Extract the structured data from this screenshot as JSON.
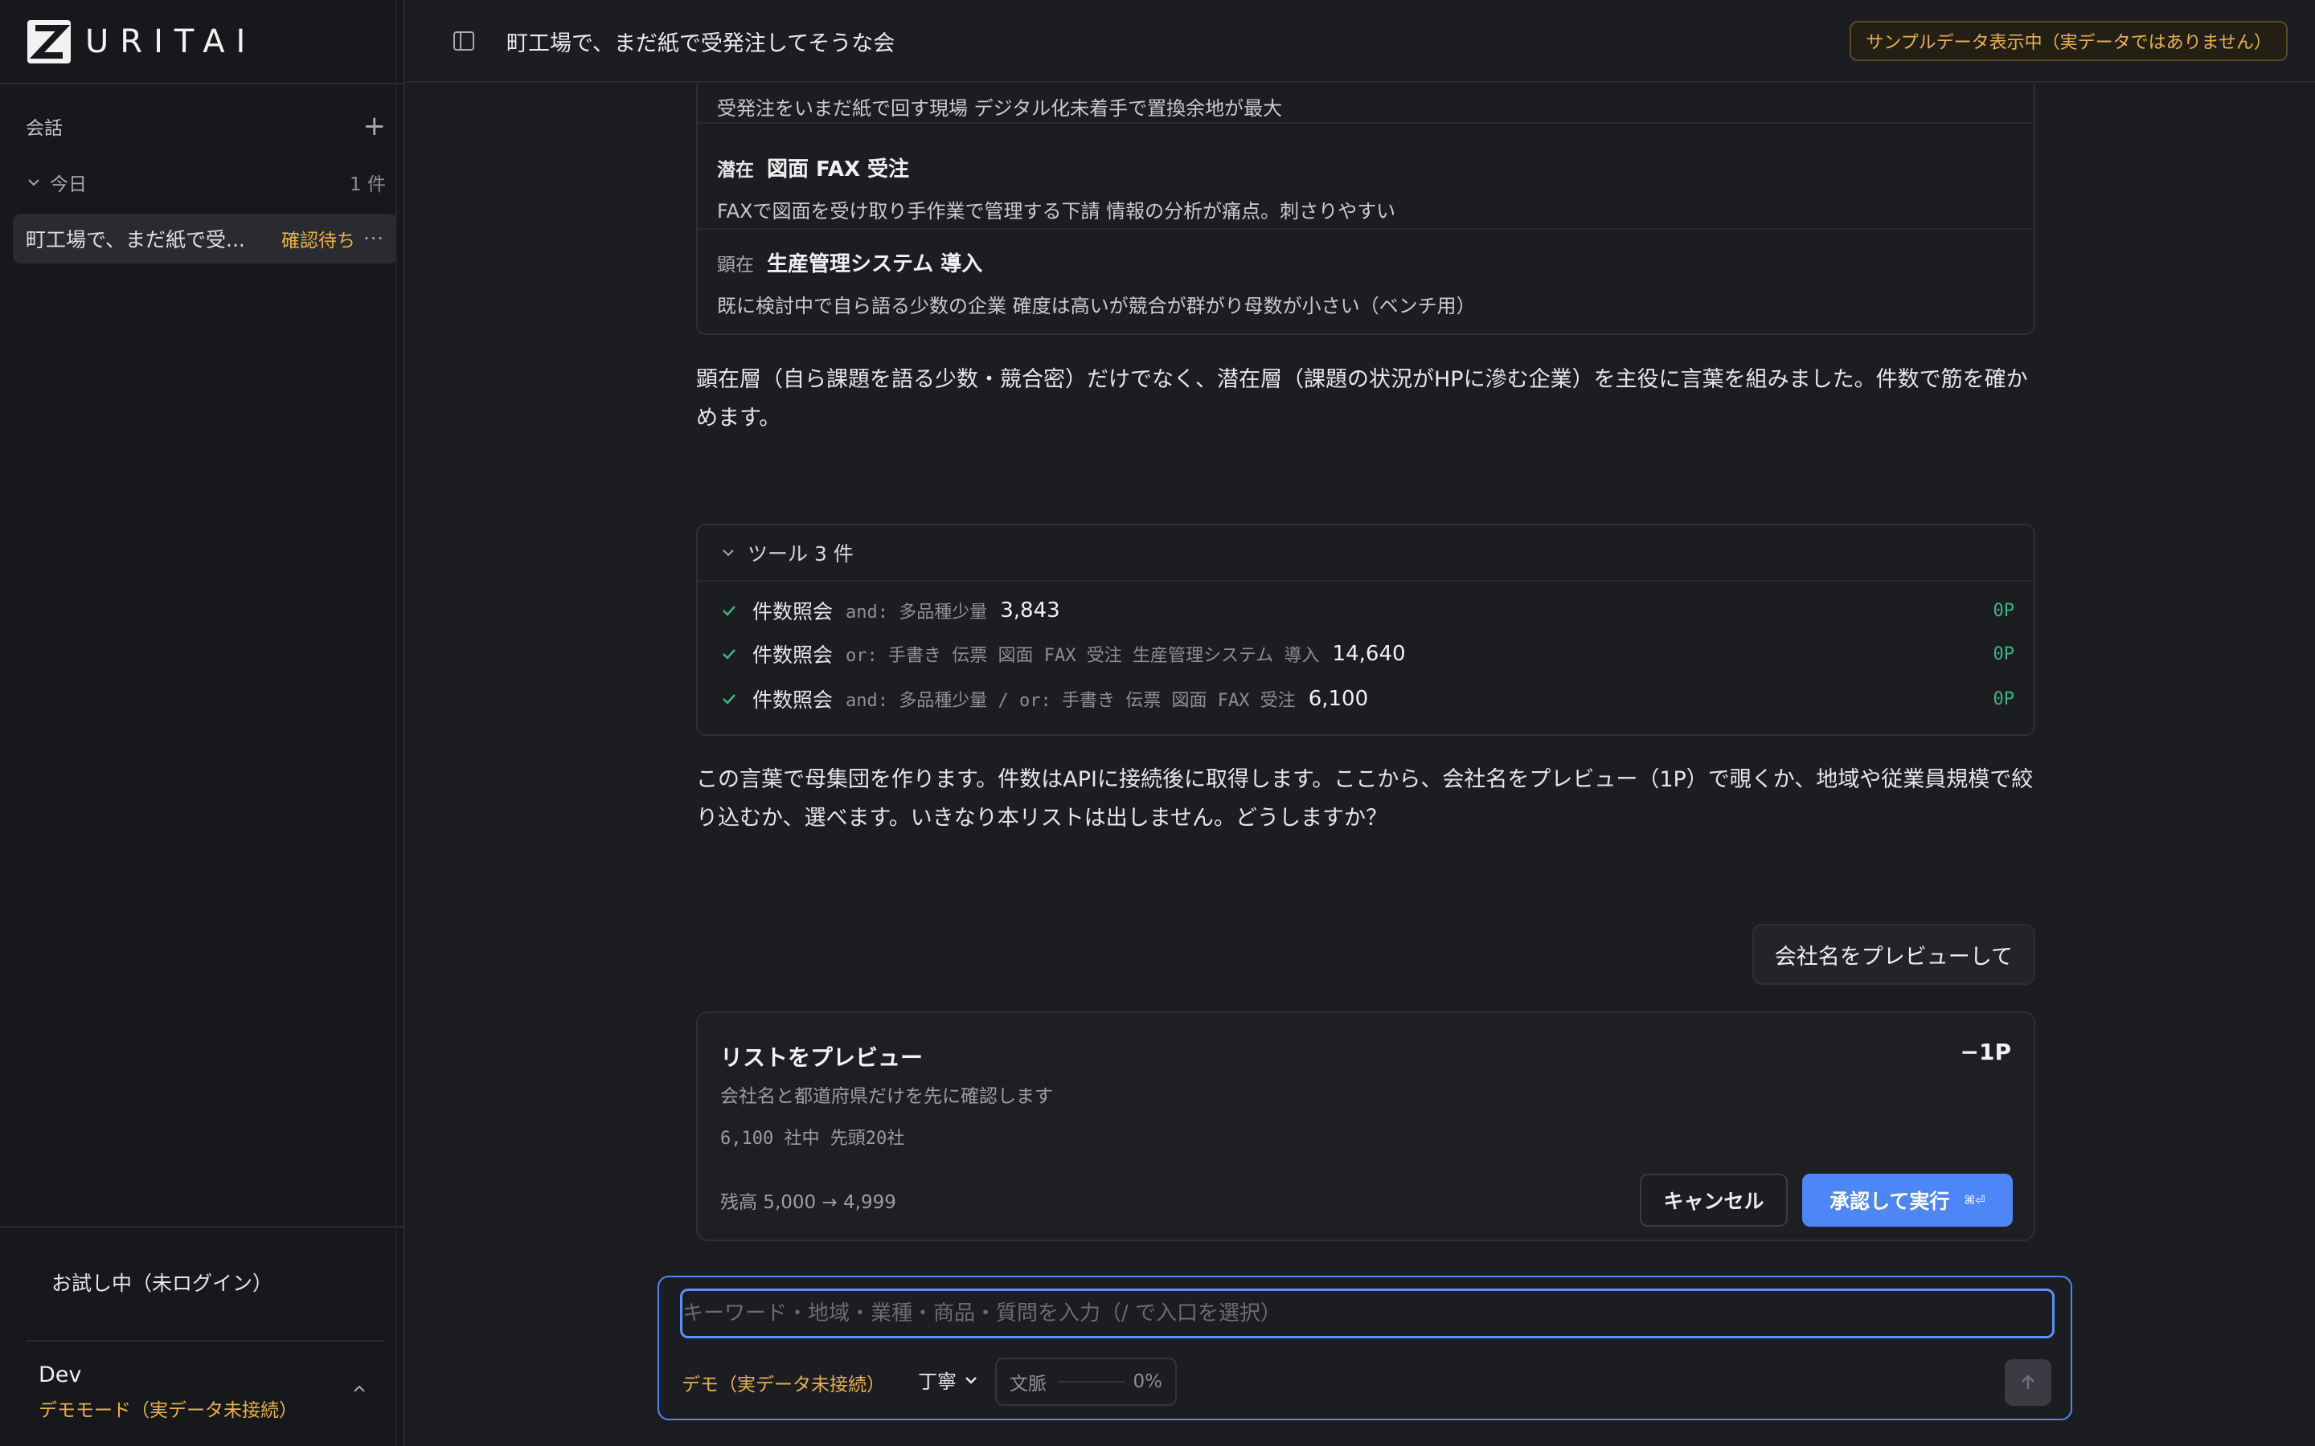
{
  "app": {
    "brand": "URITAI",
    "header_title": "町工場で、まだ紙で受発注してそうな会",
    "sample_badge": "サンプルデータ表示中（実データではありません）"
  },
  "sidebar": {
    "section_label": "会話",
    "group_label": "今日",
    "group_count": "1 件",
    "conversation": {
      "title": "町工場で、まだ紙で受...",
      "status": "確認待ち"
    },
    "trial_label": "お試し中（未ログイン）",
    "user_name": "Dev",
    "user_mode": "デモモード（実データ未接続）"
  },
  "keywords": [
    {
      "tag": "",
      "term": "",
      "desc": "受発注をいまだ紙で回す現場 デジタル化未着手で置換余地が最大"
    },
    {
      "tag": "潜在",
      "term": "図面 FAX 受注",
      "desc": "FAXで図面を受け取り手作業で管理する下請 情報の分析が痛点。刺さりやすい"
    },
    {
      "tag": "顕在",
      "term": "生産管理システム 導入",
      "desc": "既に検討中で自ら語る少数の企業 確度は高いが競合が群がり母数が小さい（ベンチ用）"
    }
  ],
  "assistant_text_1": "顕在層（自ら課題を語る少数・競合密）だけでなく、潜在層（課題の状況がHPに滲む企業）を主役に言葉を組みました。件数で筋を確かめます。",
  "tools": {
    "label": "ツール 3 件",
    "items": [
      {
        "name": "件数照会",
        "query": "and: 多品種少量",
        "count": "3,843",
        "cost": "0P"
      },
      {
        "name": "件数照会",
        "query": "or: 手書き 伝票 図面 FAX 受注 生産管理システム 導入",
        "count": "14,640",
        "cost": "0P"
      },
      {
        "name": "件数照会",
        "query": "and: 多品種少量 / or: 手書き 伝票 図面 FAX 受注",
        "count": "6,100",
        "cost": "0P"
      }
    ]
  },
  "assistant_text_2": "この言葉で母集団を作ります。件数はAPIに接続後に取得します。ここから、会社名をプレビュー（1P）で覗くか、地域や従業員規模で絞り込むか、選べます。いきなり本リストは出しません。どうしますか？",
  "user_message": "会社名をプレビューして",
  "preview": {
    "title": "リストをプレビュー",
    "cost": "−1P",
    "subtitle": "会社名と都道府県だけを先に確認します",
    "meta": "6,100 社中 先頭20社",
    "balance": "残高 5,000 → 4,999",
    "cancel_label": "キャンセル",
    "approve_label": "承認して実行",
    "approve_hint": "⌘⏎"
  },
  "composer": {
    "placeholder": "キーワード・地域・業種・商品・質問を入力（/ で入口を選択）",
    "value": "",
    "demo_label": "デモ（実データ未接続）",
    "tone": "丁寧",
    "context_label": "文脈",
    "context_pct": "0%"
  },
  "colors": {
    "accent": "#4f86f7",
    "warning": "#e8b24a",
    "success": "#3fb37f",
    "background": "#1c1d21"
  },
  "icons": [
    "logo-icon",
    "plus-icon",
    "chevron-down-icon",
    "more-icon",
    "chevron-up-icon",
    "sidebar-toggle-icon",
    "check-icon",
    "arrow-up-icon"
  ]
}
